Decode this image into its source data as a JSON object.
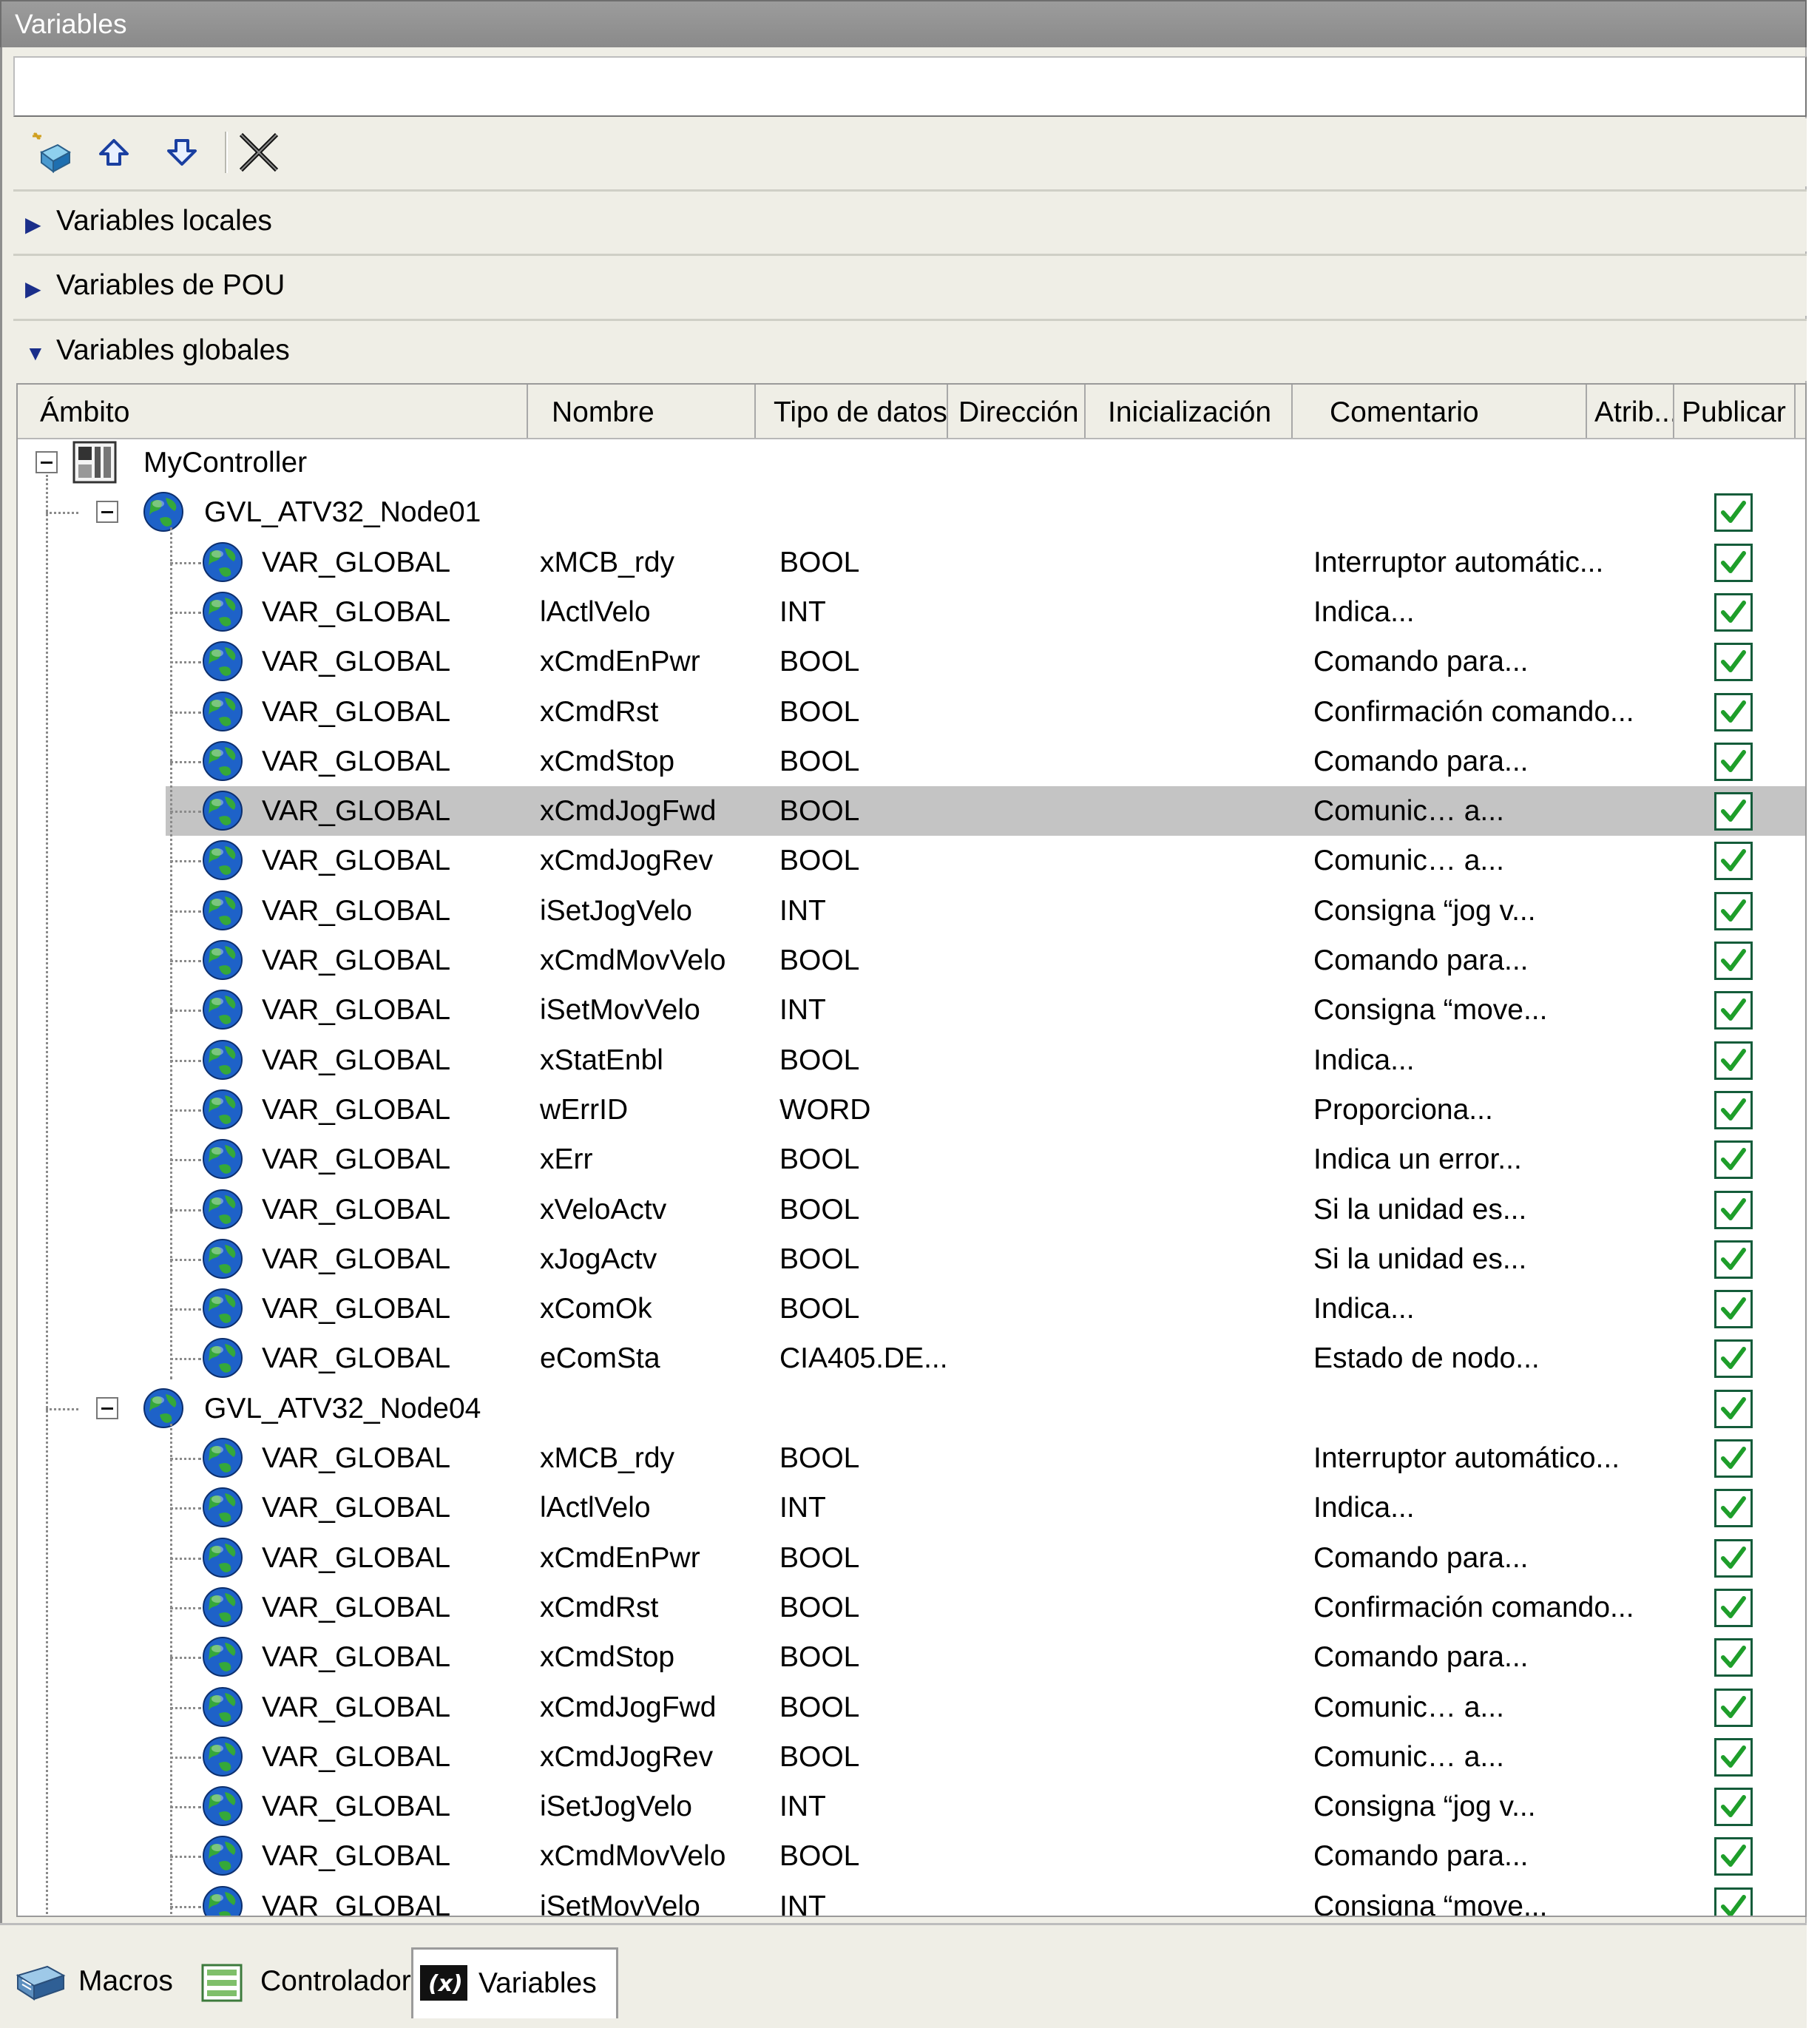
{
  "window": {
    "title": "Variables"
  },
  "filter": {
    "value": ""
  },
  "toolbar": {
    "icons": [
      "add-variable-icon",
      "arrow-up-icon",
      "arrow-down-icon",
      "delete-icon"
    ]
  },
  "sections": [
    {
      "label": "Variables locales",
      "expanded": false
    },
    {
      "label": "Variables de POU",
      "expanded": false
    },
    {
      "label": "Variables globales",
      "expanded": true
    }
  ],
  "columns": [
    "Ámbito",
    "Nombre",
    "Tipo de datos",
    "Dirección",
    "Inicialización",
    "Comentario",
    "Atrib...",
    "Publicar"
  ],
  "tree": {
    "root": "MyController",
    "groups": [
      {
        "name": "GVL_ATV32_Node01",
        "publish": true,
        "rows": [
          {
            "scope": "VAR_GLOBAL",
            "name": "xMCB_rdy",
            "type": "BOOL",
            "comment": "Interruptor automátic...",
            "publish": true
          },
          {
            "scope": "VAR_GLOBAL",
            "name": "lActlVelo",
            "type": "INT",
            "comment": "Indica...",
            "publish": true
          },
          {
            "scope": "VAR_GLOBAL",
            "name": "xCmdEnPwr",
            "type": "BOOL",
            "comment": "Comando para...",
            "publish": true
          },
          {
            "scope": "VAR_GLOBAL",
            "name": "xCmdRst",
            "type": "BOOL",
            "comment": "Confirmación comando...",
            "publish": true
          },
          {
            "scope": "VAR_GLOBAL",
            "name": "xCmdStop",
            "type": "BOOL",
            "comment": "Comando para...",
            "publish": true
          },
          {
            "scope": "VAR_GLOBAL",
            "name": "xCmdJogFwd",
            "type": "BOOL",
            "comment": "Comunic… a...",
            "publish": true,
            "selected": true
          },
          {
            "scope": "VAR_GLOBAL",
            "name": "xCmdJogRev",
            "type": "BOOL",
            "comment": "Comunic… a...",
            "publish": true
          },
          {
            "scope": "VAR_GLOBAL",
            "name": "iSetJogVelo",
            "type": "INT",
            "comment": "Consigna “jog v...",
            "publish": true
          },
          {
            "scope": "VAR_GLOBAL",
            "name": "xCmdMovVelo",
            "type": "BOOL",
            "comment": "Comando para...",
            "publish": true
          },
          {
            "scope": "VAR_GLOBAL",
            "name": "iSetMovVelo",
            "type": "INT",
            "comment": "Consigna “move...",
            "publish": true
          },
          {
            "scope": "VAR_GLOBAL",
            "name": "xStatEnbl",
            "type": "BOOL",
            "comment": "Indica...",
            "publish": true
          },
          {
            "scope": "VAR_GLOBAL",
            "name": "wErrID",
            "type": "WORD",
            "comment": "Proporciona...",
            "publish": true
          },
          {
            "scope": "VAR_GLOBAL",
            "name": "xErr",
            "type": "BOOL",
            "comment": "Indica un error...",
            "publish": true
          },
          {
            "scope": "VAR_GLOBAL",
            "name": "xVeloActv",
            "type": "BOOL",
            "comment": "Si la unidad es...",
            "publish": true
          },
          {
            "scope": "VAR_GLOBAL",
            "name": "xJogActv",
            "type": "BOOL",
            "comment": "Si la unidad es...",
            "publish": true
          },
          {
            "scope": "VAR_GLOBAL",
            "name": "xComOk",
            "type": "BOOL",
            "comment": "Indica...",
            "publish": true
          },
          {
            "scope": "VAR_GLOBAL",
            "name": "eComSta",
            "type": "CIA405.DE...",
            "comment": "Estado de nodo...",
            "publish": true
          }
        ]
      },
      {
        "name": "GVL_ATV32_Node04",
        "publish": true,
        "rows": [
          {
            "scope": "VAR_GLOBAL",
            "name": "xMCB_rdy",
            "type": "BOOL",
            "comment": "Interruptor automático...",
            "publish": true
          },
          {
            "scope": "VAR_GLOBAL",
            "name": "lActlVelo",
            "type": "INT",
            "comment": "Indica...",
            "publish": true
          },
          {
            "scope": "VAR_GLOBAL",
            "name": "xCmdEnPwr",
            "type": "BOOL",
            "comment": "Comando para...",
            "publish": true
          },
          {
            "scope": "VAR_GLOBAL",
            "name": "xCmdRst",
            "type": "BOOL",
            "comment": "Confirmación comando...",
            "publish": true
          },
          {
            "scope": "VAR_GLOBAL",
            "name": "xCmdStop",
            "type": "BOOL",
            "comment": "Comando para...",
            "publish": true
          },
          {
            "scope": "VAR_GLOBAL",
            "name": "xCmdJogFwd",
            "type": "BOOL",
            "comment": "Comunic… a...",
            "publish": true
          },
          {
            "scope": "VAR_GLOBAL",
            "name": "xCmdJogRev",
            "type": "BOOL",
            "comment": "Comunic… a...",
            "publish": true
          },
          {
            "scope": "VAR_GLOBAL",
            "name": "iSetJogVelo",
            "type": "INT",
            "comment": "Consigna “jog v...",
            "publish": true
          },
          {
            "scope": "VAR_GLOBAL",
            "name": "xCmdMovVelo",
            "type": "BOOL",
            "comment": "Comando para...",
            "publish": true
          },
          {
            "scope": "VAR_GLOBAL",
            "name": "iSetMovVelo",
            "type": "INT",
            "comment": "Consigna “move...",
            "publish": true
          }
        ]
      }
    ]
  },
  "bottom_tabs": [
    {
      "label": "Macros",
      "icon": "macros-icon",
      "active": false
    },
    {
      "label": "Controlador",
      "icon": "controller-icon",
      "active": false
    },
    {
      "label": "Variables",
      "icon": "variables-icon",
      "active": true
    }
  ],
  "colors": {
    "selected_row": "#c4c4c4",
    "check": "#1e9e2a",
    "triangle": "#1a2e8a",
    "panel": "#efeee6"
  }
}
